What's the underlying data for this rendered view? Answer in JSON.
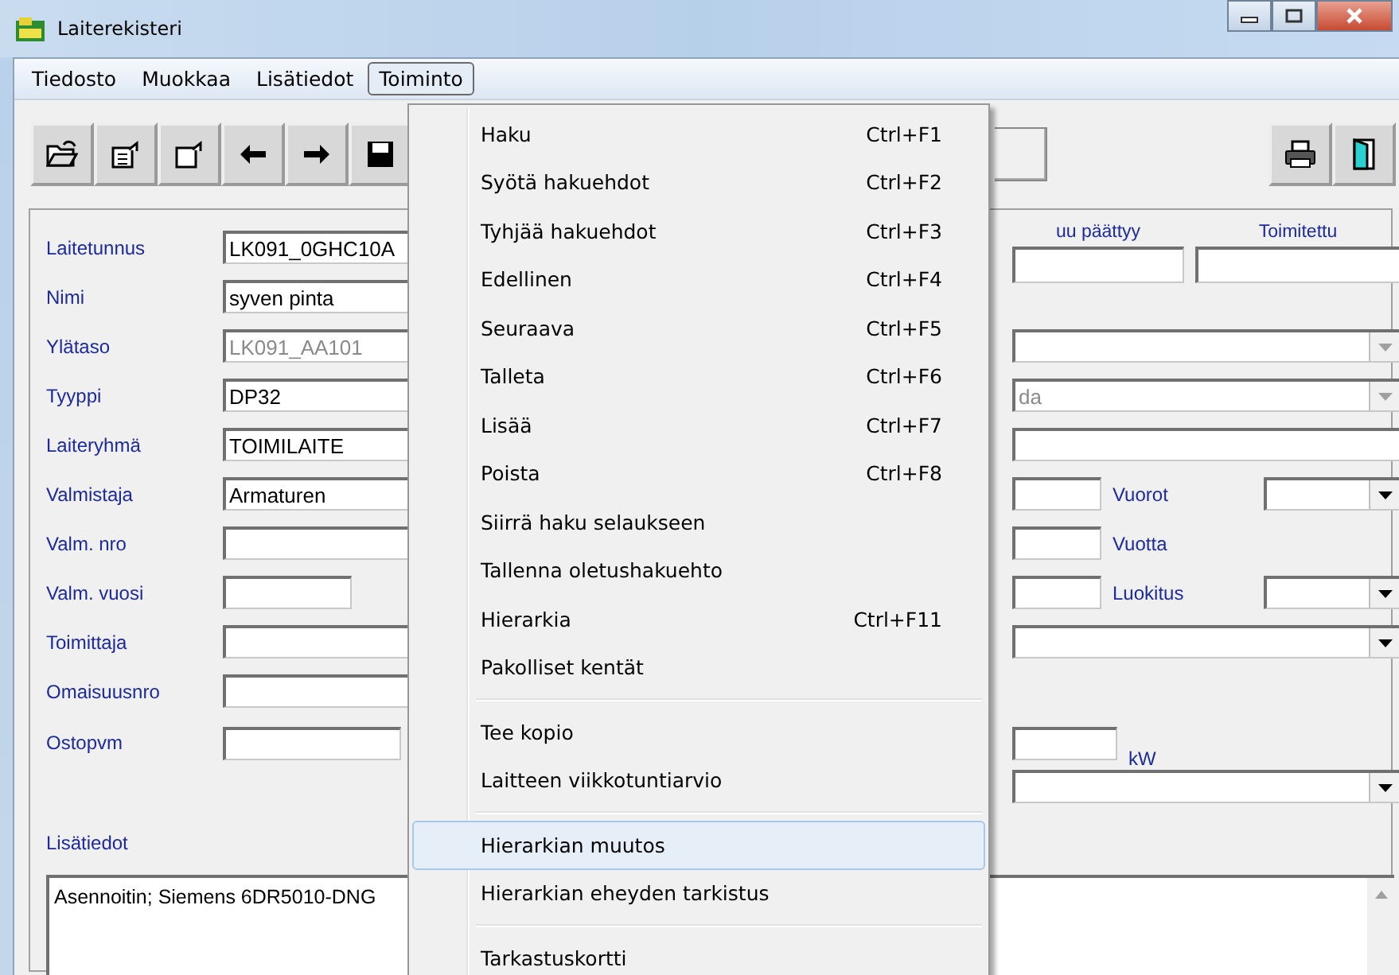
{
  "window": {
    "title": "Laiterekisteri"
  },
  "menubar": [
    {
      "label": "Tiedosto",
      "selected": false
    },
    {
      "label": "Muokkaa",
      "selected": false
    },
    {
      "label": "Lisätiedot",
      "selected": false
    },
    {
      "label": "Toiminto",
      "selected": true
    }
  ],
  "toolbar": {
    "left": [
      {
        "kind": "folder"
      },
      {
        "kind": "form"
      },
      {
        "kind": "form2"
      },
      {
        "kind": "left"
      },
      {
        "kind": "right"
      },
      {
        "kind": "floppy"
      }
    ],
    "right": [
      {
        "kind": "printer"
      },
      {
        "kind": "door"
      }
    ]
  },
  "form": {
    "fields": [
      {
        "label": "Laitetunnus",
        "value": "LK091_0GHC10A",
        "disabled": false
      },
      {
        "label": "Nimi",
        "value": "syven pinta",
        "disabled": false
      },
      {
        "label": "Ylätaso",
        "value": "LK091_AA101",
        "disabled": true
      },
      {
        "label": "Tyyppi",
        "value": "DP32",
        "disabled": false
      },
      {
        "label": "Laiteryhmä",
        "value": "TOIMILAITE",
        "disabled": false
      },
      {
        "label": "Valmistaja",
        "value": "Armaturen",
        "disabled": false
      },
      {
        "label": "Valm. nro"
      },
      {
        "label": "Valm. vuosi"
      },
      {
        "label": "Toimittaja"
      },
      {
        "label": "Omaisuusnro"
      },
      {
        "label": "Ostopvm"
      }
    ],
    "right_header": [
      {
        "label": "uu päättyy"
      },
      {
        "label": "Toimitettu"
      }
    ],
    "right_rows": [
      [
        {
          "kind": "dropdown",
          "disabled": true
        }
      ],
      [
        {
          "kind": "dropdown",
          "value": "da",
          "disabled": true
        }
      ],
      [
        {
          "kind": "field"
        }
      ],
      [
        {
          "kind": "short_field"
        },
        {
          "kind": "label",
          "label": "Vuorot"
        },
        {
          "kind": "short_dropdown",
          "disabled": false
        }
      ],
      [
        {
          "kind": "short_field"
        },
        {
          "kind": "label",
          "label": "Vuotta"
        }
      ],
      [
        {
          "kind": "short_field"
        },
        {
          "kind": "label",
          "label": "Luokitus"
        },
        {
          "kind": "short_dropdown",
          "disabled": false
        }
      ],
      [
        {
          "kind": "dropdown",
          "disabled": false
        }
      ],
      [],
      [
        {
          "kind": "unit_field"
        },
        {
          "kind": "unit",
          "label": "kW"
        }
      ],
      [
        {
          "kind": "dropdown",
          "disabled": false
        }
      ]
    ],
    "notes": {
      "label": "Lisätiedot",
      "value": "Asennoitin; Siemens 6DR5010-DNG"
    }
  },
  "menu": [
    {
      "kind": "item",
      "label": "Haku",
      "shortcut": "Ctrl+F1",
      "selected": false
    },
    {
      "kind": "item",
      "label": "Syötä hakuehdot",
      "shortcut": "Ctrl+F2",
      "selected": false
    },
    {
      "kind": "item",
      "label": "Tyhjää hakuehdot",
      "shortcut": "Ctrl+F3",
      "selected": false
    },
    {
      "kind": "item",
      "label": "Edellinen",
      "shortcut": "Ctrl+F4",
      "selected": false
    },
    {
      "kind": "item",
      "label": "Seuraava",
      "shortcut": "Ctrl+F5",
      "selected": false
    },
    {
      "kind": "item",
      "label": "Talleta",
      "shortcut": "Ctrl+F6",
      "selected": false
    },
    {
      "kind": "item",
      "label": "Lisää",
      "shortcut": "Ctrl+F7",
      "selected": false
    },
    {
      "kind": "item",
      "label": "Poista",
      "shortcut": "Ctrl+F8",
      "selected": false
    },
    {
      "kind": "item",
      "label": "Siirrä haku selaukseen",
      "selected": false
    },
    {
      "kind": "item",
      "label": "Tallenna oletushakuehto",
      "selected": false
    },
    {
      "kind": "item",
      "label": "Hierarkia",
      "shortcut": "Ctrl+F11",
      "selected": false
    },
    {
      "kind": "item",
      "label": "Pakolliset kentät",
      "selected": false
    },
    {
      "kind": "separator"
    },
    {
      "kind": "item",
      "label": "Tee kopio",
      "selected": false
    },
    {
      "kind": "item",
      "label": "Laitteen viikkotuntiarvio",
      "selected": false
    },
    {
      "kind": "separator"
    },
    {
      "kind": "item",
      "label": "Hierarkian muutos",
      "selected": true
    },
    {
      "kind": "item",
      "label": "Hierarkian eheyden tarkistus",
      "selected": false
    },
    {
      "kind": "separator"
    },
    {
      "kind": "item",
      "label": "Tarkastuskortti",
      "selected": false
    }
  ]
}
